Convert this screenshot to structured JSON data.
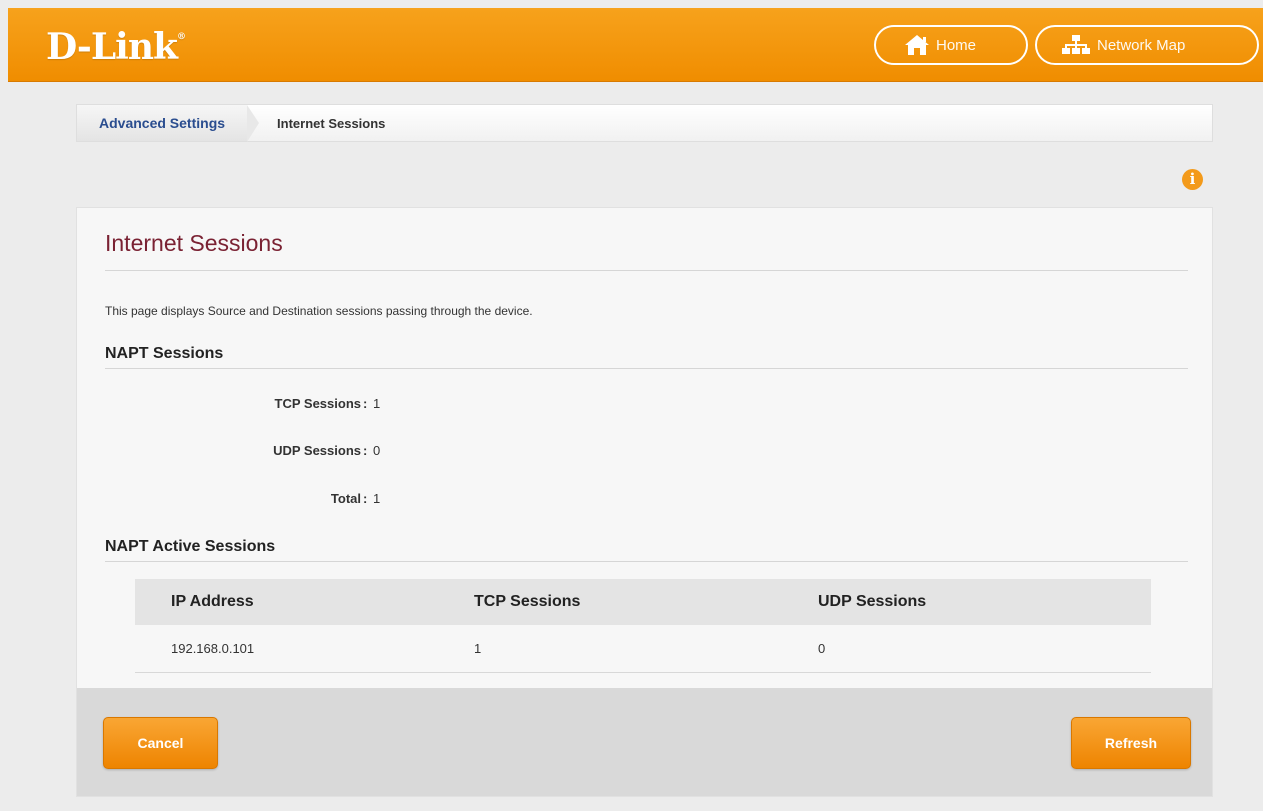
{
  "header": {
    "logo": "D-Link",
    "home_label": "Home",
    "network_map_label": "Network Map"
  },
  "breadcrumb": {
    "parent": "Advanced Settings",
    "current": "Internet Sessions"
  },
  "panel": {
    "title": "Internet Sessions",
    "description": "This page displays Source and Destination sessions passing through the device."
  },
  "napt": {
    "title": "NAPT Sessions",
    "stats": [
      {
        "label": "TCP Sessions",
        "value": "1"
      },
      {
        "label": "UDP Sessions",
        "value": "0"
      },
      {
        "label": "Total",
        "value": "1"
      }
    ]
  },
  "active": {
    "title": "NAPT Active Sessions",
    "columns": [
      "IP Address",
      "TCP Sessions",
      "UDP Sessions"
    ],
    "rows": [
      [
        "192.168.0.101",
        "1",
        "0"
      ]
    ]
  },
  "buttons": {
    "cancel": "Cancel",
    "refresh": "Refresh"
  },
  "colors": {
    "accent": "#f39200",
    "title": "#7a2233",
    "link": "#2a4d8f"
  },
  "icons": {
    "home": "home-icon",
    "network_map": "network-map-icon",
    "info": "info-icon"
  }
}
